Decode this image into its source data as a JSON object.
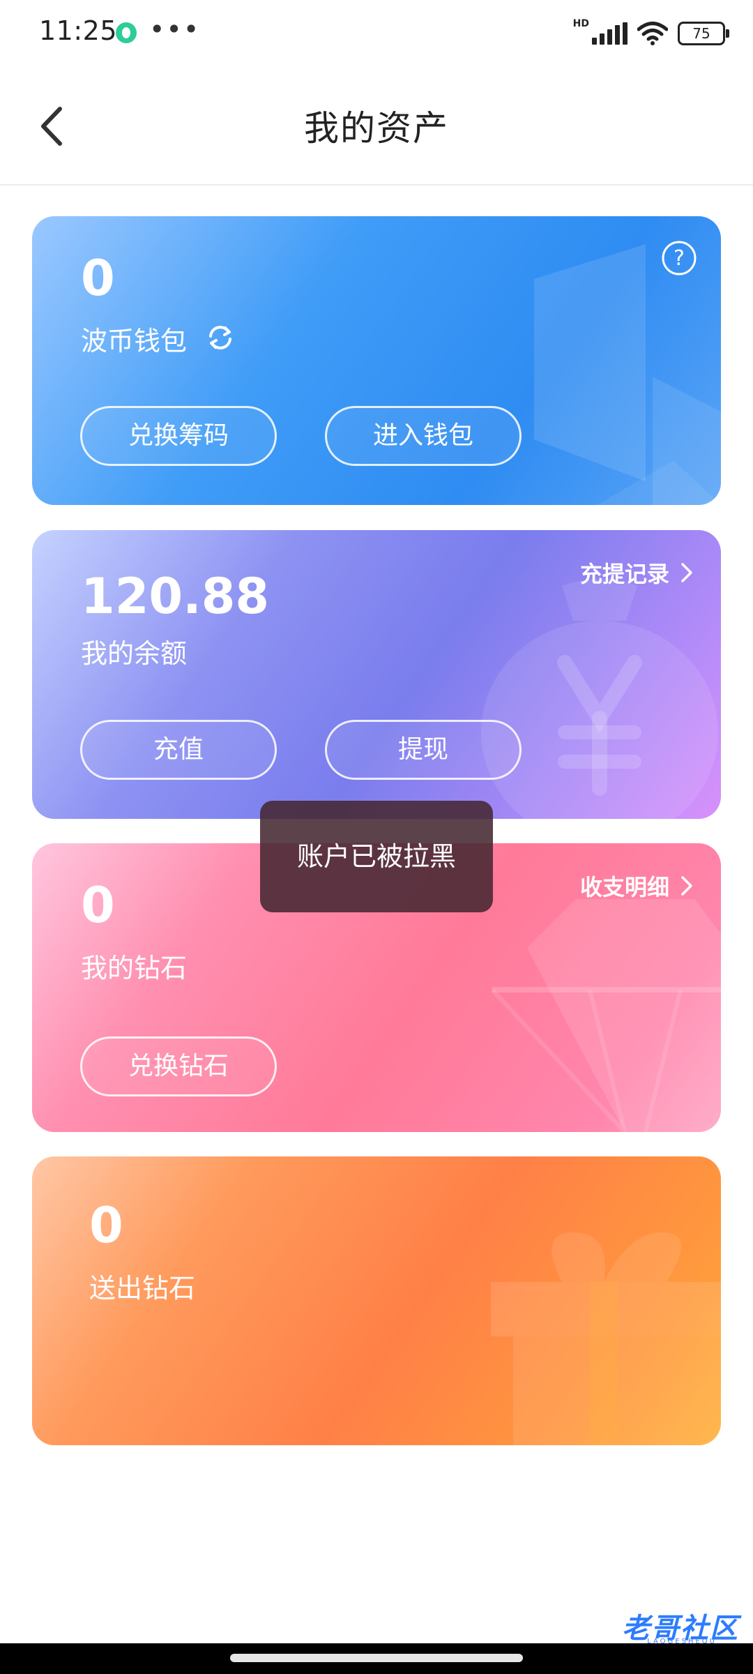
{
  "status_bar": {
    "time": "11:25",
    "dots": "•••",
    "network": "HD",
    "battery": "75",
    "icons": [
      "app-notification-icon",
      "signal-icon",
      "wifi-icon",
      "battery-icon"
    ]
  },
  "header": {
    "title": "我的资产",
    "back_icon": "chevron-left-icon"
  },
  "cards": {
    "wallet": {
      "amount": "0",
      "label": "波币钱包",
      "refresh_icon": "refresh-icon",
      "help_icon": "help-icon",
      "buttons": [
        "兑换筹码",
        "进入钱包"
      ],
      "color": "#3f9cf7"
    },
    "balance": {
      "amount": "120.88",
      "label": "我的余额",
      "link": "充提记录",
      "buttons": [
        "充值",
        "提现"
      ],
      "color": "#7a7ded"
    },
    "diamond": {
      "amount": "0",
      "label": "我的钻石",
      "link": "收支明细",
      "buttons": [
        "兑换钻石"
      ],
      "color": "#ff7a98"
    },
    "sent": {
      "amount": "0",
      "label": "送出钻石",
      "color": "#ff8047"
    }
  },
  "toast": {
    "message": "账户已被拉黑"
  },
  "watermark": {
    "text": "老哥社区",
    "sub": "LAOGESHEQU"
  }
}
